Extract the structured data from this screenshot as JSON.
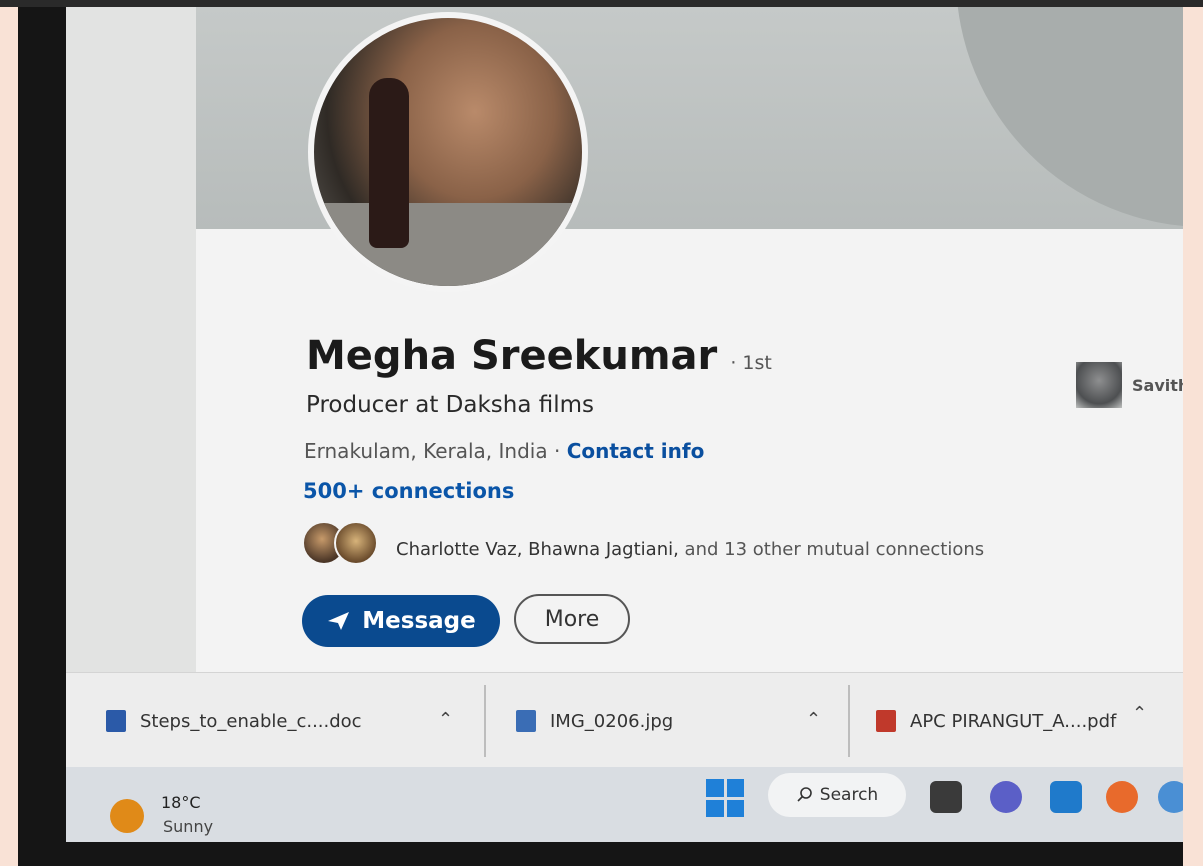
{
  "profile": {
    "name": "Megha Sreekumar",
    "degree": "· 1st",
    "headline": "Producer at Daksha films",
    "location": "Ernakulam, Kerala, India ·",
    "contact_info": "Contact info",
    "connections": "500+ connections",
    "mutual": {
      "names": "Charlotte Vaz, Bhawna Jagtiani,",
      "rest": " and 13 other mutual connections"
    },
    "message_button": "Message",
    "more_button": "More",
    "message_icon": "send-icon"
  },
  "sidebar": {
    "person_name": "Savith"
  },
  "downloads": [
    {
      "name": "Steps_to_enable_c....doc",
      "icon": "word-doc-icon",
      "color": "#2b5aa8"
    },
    {
      "name": "IMG_0206.jpg",
      "icon": "image-file-icon",
      "color": "#3a6db5"
    },
    {
      "name": "APC PIRANGUT_A....pdf",
      "icon": "pdf-file-icon",
      "color": "#c0392b"
    }
  ],
  "taskbar": {
    "temperature": "18°C",
    "condition": "Sunny",
    "search_label": "Search",
    "weather_icon": "sun-icon",
    "start_icon": "windows-start-icon"
  },
  "colors": {
    "linkedin_blue": "#0a4a8f",
    "link_text": "#0a55a8",
    "windows_blue": "#1f80d8"
  }
}
